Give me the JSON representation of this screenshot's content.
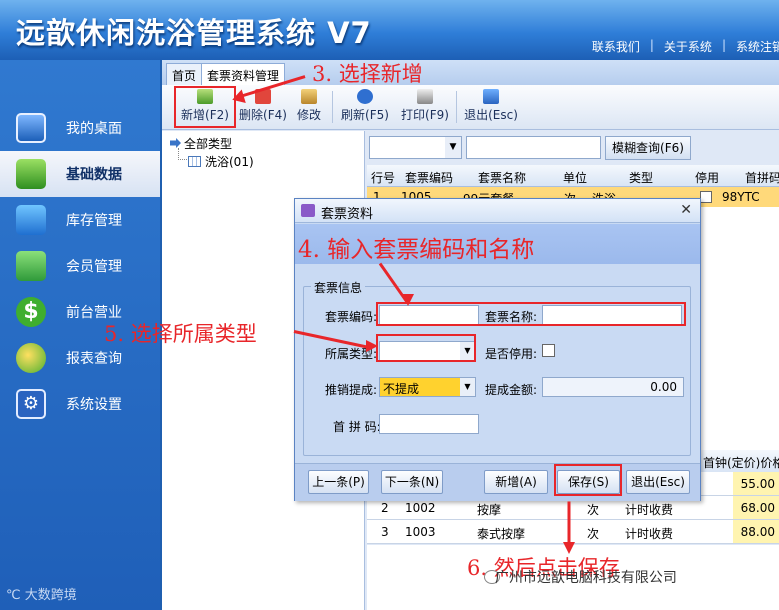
{
  "app": {
    "title": "远歆休闲洗浴管理系统 V7",
    "top_links": [
      "联系我们",
      "关于系统",
      "系统注销"
    ]
  },
  "sidebar": {
    "items": [
      {
        "label": "我的桌面",
        "icon": "desktop-icon"
      },
      {
        "label": "基础数据",
        "icon": "base-data-icon",
        "active": true
      },
      {
        "label": "库存管理",
        "icon": "inventory-icon"
      },
      {
        "label": "会员管理",
        "icon": "member-card-icon"
      },
      {
        "label": "前台营业",
        "icon": "dollar-icon"
      },
      {
        "label": "报表查询",
        "icon": "report-icon"
      },
      {
        "label": "系统设置",
        "icon": "gear-icon"
      }
    ]
  },
  "tabs": [
    {
      "label": "首页"
    },
    {
      "label": "套票资料管理",
      "active": true
    }
  ],
  "toolbar": {
    "new": "新增(F2)",
    "delete": "删除(F4)",
    "edit": "修改",
    "refresh": "刷新(F5)",
    "print": "打印(F9)",
    "exit": "退出(Esc)"
  },
  "tree": {
    "root": "全部类型",
    "child": "洗浴(01)"
  },
  "search": {
    "fuzzy_button": "模糊查询(F6)"
  },
  "grid": {
    "headers": [
      "行号",
      "套票编码",
      "套票名称",
      "单位",
      "类型",
      "停用",
      "首拼码"
    ],
    "row1": {
      "no": "1",
      "code": "1005",
      "name": "99元套餐",
      "unit": "次",
      "type": "洗浴",
      "pinyin": "98YTC"
    },
    "headers2_partial": "首钟(定价)价格",
    "rows": [
      {
        "no": "1",
        "code": "1001",
        "name": "足疗",
        "unit": "次",
        "type": "计时收费",
        "price": "55.00"
      },
      {
        "no": "2",
        "code": "1002",
        "name": "按摩",
        "unit": "次",
        "type": "计时收费",
        "price": "68.00"
      },
      {
        "no": "3",
        "code": "1003",
        "name": "泰式按摩",
        "unit": "次",
        "type": "计时收费",
        "price": "88.00"
      }
    ]
  },
  "dialog": {
    "title": "套票资料",
    "group_title": "套票信息",
    "code_label": "套票编码:",
    "name_label": "套票名称:",
    "type_label": "所属类型:",
    "disabled_label": "是否停用:",
    "commission_label": "推销提成:",
    "commission_value": "不提成",
    "amount_label": "提成金额:",
    "amount_value": "0.00",
    "pinyin_label": "首 拼 码:",
    "buttons": {
      "prev": "上一条(P)",
      "next": "下一条(N)",
      "new": "新增(A)",
      "save": "保存(S)",
      "exit": "退出(Esc)"
    }
  },
  "annotations": {
    "step3": "3. 选择新增",
    "step4": "4. 输入套票编码和名称",
    "step5": "5. 选择所属类型",
    "step6": "6. 然后点击保存"
  },
  "watermarks": {
    "left": "大数跨境",
    "right": "广州市远歆电脑科技有限公司"
  },
  "colors": {
    "annotation_red": "#e8262a",
    "selected_row": "#ffd97a",
    "commission_select": "#ffd22e"
  }
}
